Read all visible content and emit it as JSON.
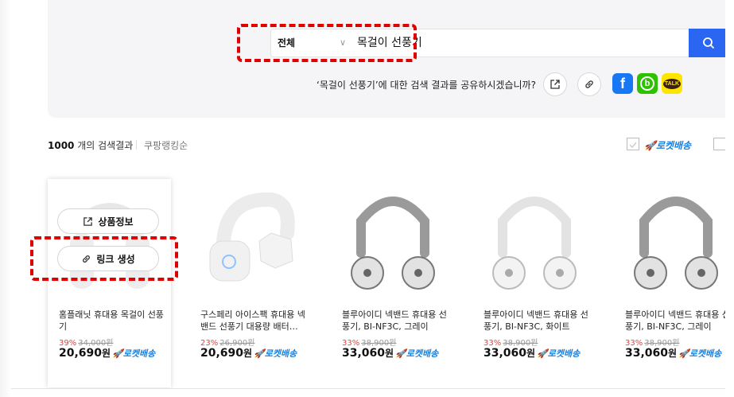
{
  "search": {
    "scope_label": "전체",
    "query": "목걸이 선풍기",
    "button_icon": "search-icon"
  },
  "share": {
    "prompt": "‘목걸이 선풍기’에 대한 검색 결과를 공유하시겠습니까?",
    "buttons": [
      "external-link-icon",
      "link-icon",
      "facebook-icon",
      "band-icon",
      "kakaotalk-icon"
    ],
    "facebook_glyph": "f",
    "band_glyph": "b",
    "talk_glyph": "TALK"
  },
  "results": {
    "count": "1000",
    "count_suffix": "개의 검색결과",
    "sort_label": "쿠팡랭킹순",
    "filter_label": "🚀로켓배송"
  },
  "hover_actions": {
    "info": "상품정보",
    "link": "링크 생성"
  },
  "products": [
    {
      "title": "홈플래닛 휴대용 목걸이 선풍기",
      "discount": "39%",
      "original": "34,000원",
      "price": "20,690",
      "won": "원",
      "badge": "🚀로켓배송"
    },
    {
      "title": "구스페리 아이스팩 휴대용 넥밴드 선풍기 대용량 배터…",
      "discount": "23%",
      "original": "26,900원",
      "price": "20,690",
      "won": "원",
      "badge": "🚀로켓배송"
    },
    {
      "title": "블루아이디 넥밴드 휴대용 선풍기, BI-NF3C, 그레이",
      "discount": "33%",
      "original": "38,900원",
      "price": "33,060",
      "won": "원",
      "badge": "🚀로켓배송"
    },
    {
      "title": "블루아이디 넥밴드 휴대용 선풍기, BI-NF3C, 화이트",
      "discount": "33%",
      "original": "38,900원",
      "price": "33,060",
      "won": "원",
      "badge": "🚀로켓배송"
    },
    {
      "title": "블루아이디 넥밴드 휴대용 선풍기, BI-NF3C, 그레이",
      "discount": "33%",
      "original": "38,900원",
      "price": "33,060",
      "won": "원",
      "badge": "🚀로켓배송"
    }
  ],
  "colors": {
    "accent": "#2a66f1",
    "rocket": "#1a7fdb",
    "annotation": "#e10000",
    "facebook": "#1877f2",
    "band": "#2dc100",
    "kakao": "#fee500"
  }
}
